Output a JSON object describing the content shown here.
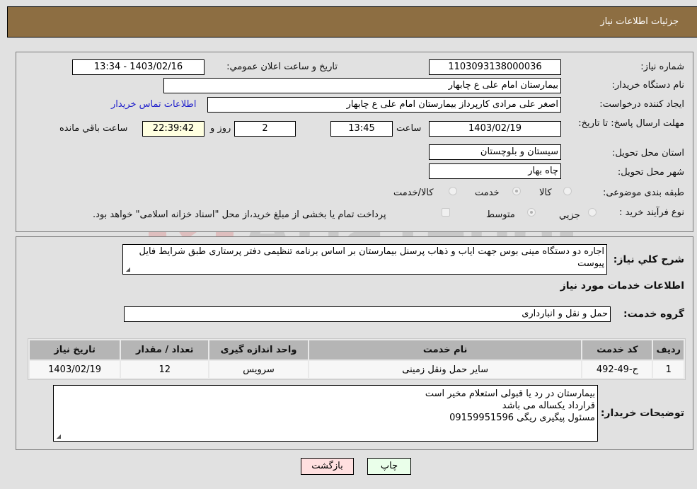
{
  "header": {
    "title": "جزئیات اطلاعات نیاز"
  },
  "details": {
    "need_number": {
      "label": "شماره نیاز:",
      "value": "1103093138000036"
    },
    "announce_datetime": {
      "label": "تاریخ و ساعت اعلان عمومي:",
      "value": "1403/02/16 - 13:34"
    },
    "buyer_org": {
      "label": "نام دستگاه خريدار:",
      "value": "بیمارستان امام علی  ع  چابهار"
    },
    "requester": {
      "label": "ايجاد کننده درخواست:",
      "value": "اصغر علی مرادی کارپرداز بیمارستان امام علی  ع  چابهار"
    },
    "buyer_contact_link": "اطلاعات تماس خريدار",
    "deadline": {
      "label": "مهلت ارسال پاسخ: تا تاریخ:",
      "date": "1403/02/19",
      "time_label": "ساعت",
      "time": "13:45",
      "days": "2",
      "days_label": "روز و",
      "remaining": "22:39:42",
      "remaining_label": "ساعت باقي مانده"
    },
    "province": {
      "label": "استان محل تحویل:",
      "value": "سیستان و بلوچستان"
    },
    "city": {
      "label": "شهر محل تحویل:",
      "value": "چاه بهار"
    },
    "category": {
      "label": "طبقه بندی موضوعی:",
      "options": [
        "کالا",
        "خدمت",
        "کالا/خدمت"
      ],
      "selected": "خدمت"
    },
    "purchase_type": {
      "label": "نوع فرآیند خرید :",
      "options": [
        "جزيي",
        "متوسط"
      ],
      "selected": "متوسط",
      "treasury_note": "پرداخت تمام یا بخشی از مبلغ خرید،از محل \"اسناد خزانه اسلامی\" خواهد بود.",
      "treasury_checked": false
    }
  },
  "description": {
    "label": "شرح کلي نياز:",
    "value": "اجاره دو دستگاه مینی بوس جهت ایاب و ذهاب پرسنل بیمارستان بر اساس برنامه تنظیمی دفتر پرستاری طبق شرایط فایل پیوست"
  },
  "services_section": {
    "title": "اطلاعات خدمات مورد نياز",
    "group_label": "گروه خدمت:",
    "group_value": "حمل و نقل و انبارداری",
    "table": {
      "headers": [
        "رديف",
        "کد خدمت",
        "نام خدمت",
        "واحد اندازه گيری",
        "تعداد / مقدار",
        "تاريخ نياز"
      ],
      "rows": [
        [
          "1",
          "ح-49-492",
          "سایر حمل ونقل زمینی",
          "سرویس",
          "12",
          "1403/02/19"
        ]
      ]
    }
  },
  "buyer_notes": {
    "label": "توضيحات خريدار:",
    "lines": [
      "بیمارستان در رد یا قبولی استعلام مخیر است",
      "قرارداد  یکساله می باشد",
      "مسئول پیگیری ریگی 09159951596"
    ]
  },
  "buttons": {
    "print": "چاپ",
    "back": "بازگشت"
  },
  "colors": {
    "header_bg": "#8d6e42",
    "print_bg": "#eaffea",
    "back_bg": "#ffe0e0",
    "link": "#2222cc"
  },
  "watermark": {
    "text": "AriaTender.neT"
  }
}
